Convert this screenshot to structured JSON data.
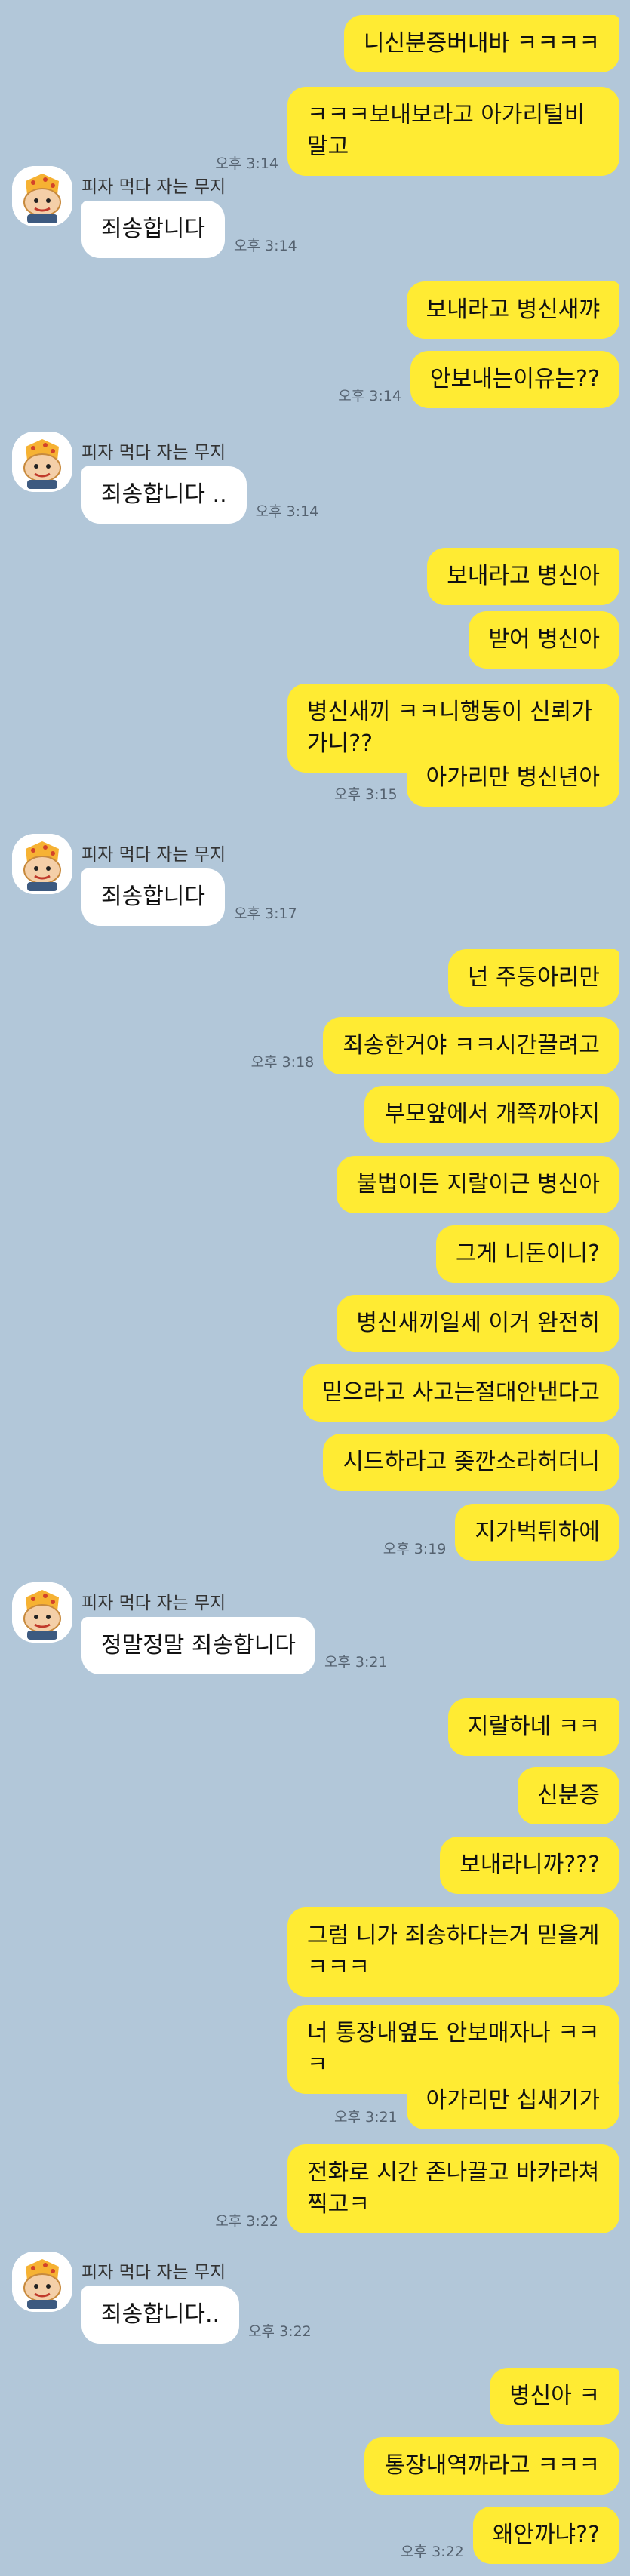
{
  "chat": {
    "partner_name": "피자 먹다 자는 무지",
    "sent": [
      {
        "text": "니신분증버내바 ㅋㅋㅋㅋ",
        "time": ""
      },
      {
        "text": "ㅋㅋㅋ보내보라고 아가리털비말고",
        "time": "오후 3:14"
      },
      {
        "text": "보내라고 병신새꺄",
        "time": ""
      },
      {
        "text": "안보내는이유는??",
        "time": "오후 3:14"
      },
      {
        "text": "보내라고 병신아",
        "time": ""
      },
      {
        "text": "받어 병신아",
        "time": ""
      },
      {
        "text": "병신새끼 ㅋㅋ니행동이 신뢰가가니??",
        "time": ""
      },
      {
        "text": "아가리만 병신년아",
        "time": "오후 3:15"
      },
      {
        "text": "넌 주둥아리만",
        "time": ""
      },
      {
        "text": "죄송한거야 ㅋㅋ시간끌려고",
        "time": "오후 3:18"
      },
      {
        "text": "부모앞에서 개쪽까야지",
        "time": ""
      },
      {
        "text": "불법이든 지랄이근 병신아",
        "time": ""
      },
      {
        "text": "그게 니돈이니?",
        "time": ""
      },
      {
        "text": "병신새끼일세 이거 완전히",
        "time": ""
      },
      {
        "text": "믿으라고 사고는절대안낸다고",
        "time": ""
      },
      {
        "text": "시드하라고 좆깐소라허더니",
        "time": ""
      },
      {
        "text": "지가벅튀하에",
        "time": "오후 3:19"
      },
      {
        "text": "지랄하네 ㅋㅋ",
        "time": ""
      },
      {
        "text": "신분증",
        "time": ""
      },
      {
        "text": "보내라니까???",
        "time": ""
      },
      {
        "text": "그럼 니가 죄송하다는거 믿을게 ㅋㅋㅋ",
        "time": ""
      },
      {
        "text": "너 통장내옆도 안보매자나 ㅋㅋㅋ",
        "time": ""
      },
      {
        "text": "아가리만 십새기가",
        "time": "오후 3:21"
      },
      {
        "text": "전화로 시간 존나끌고 바카라쳐찍고ㅋ",
        "time": "오후 3:22"
      },
      {
        "text": "병신아 ㅋ",
        "time": ""
      },
      {
        "text": "통장내역까라고 ㅋㅋㅋ",
        "time": ""
      },
      {
        "text": "왜안까냐??",
        "time": "오후 3:22"
      }
    ],
    "received": [
      {
        "text": "죄송합니다",
        "time": "오후 3:14"
      },
      {
        "text": "죄송합니다 ..",
        "time": "오후 3:14"
      },
      {
        "text": "죄송합니다",
        "time": "오후 3:17"
      },
      {
        "text": "정말정말 죄송합니다",
        "time": "오후 3:21"
      },
      {
        "text": "죄송합니다..",
        "time": "오후 3:22"
      }
    ]
  },
  "colors": {
    "background": "#b2c7d9",
    "sent_bubble": "#ffeb33",
    "received_bubble": "#ffffff"
  },
  "icons": {
    "avatar": "muzi-pizza-avatar"
  }
}
